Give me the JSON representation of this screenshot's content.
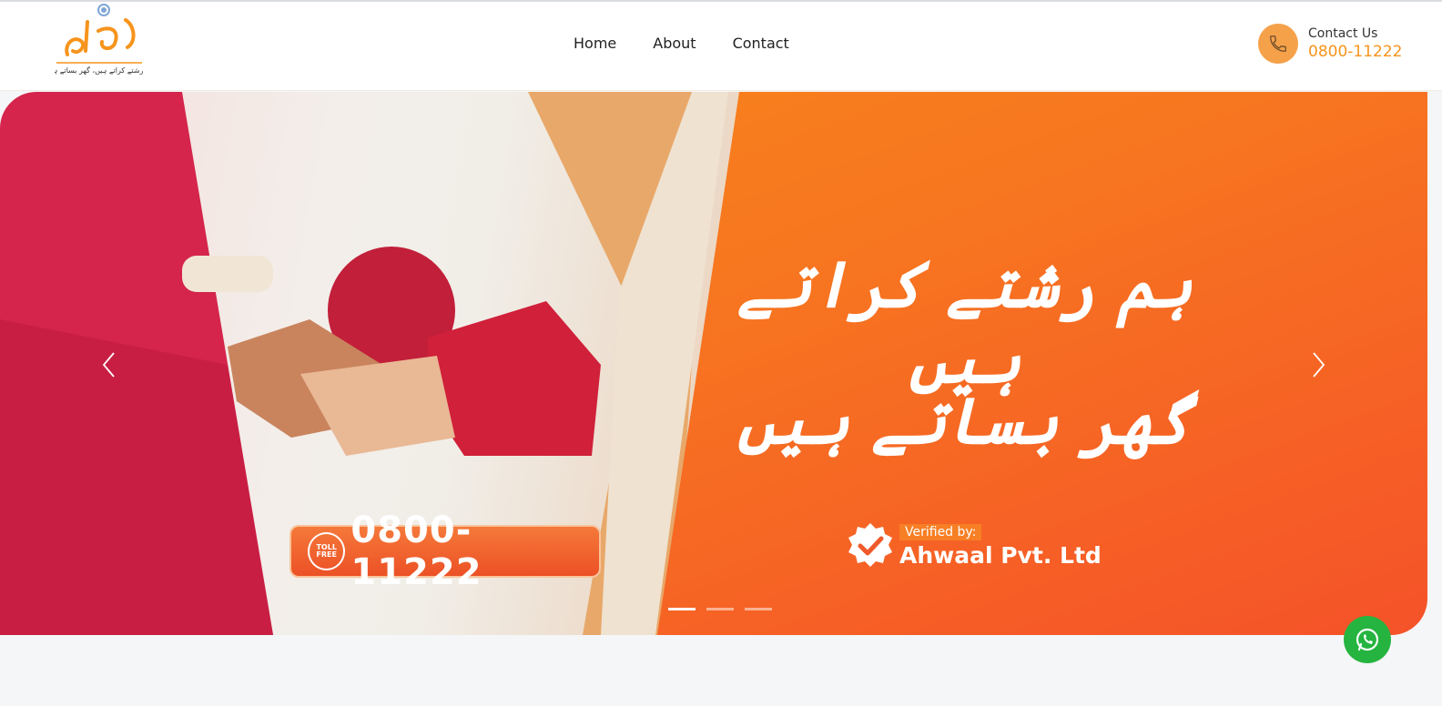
{
  "brand": {
    "logo_text": "احوال",
    "tagline": "ہم رشتے کراتے ہیں، گھر بساتے ہیں",
    "accent_color": "#f7941d"
  },
  "nav": {
    "items": [
      {
        "label": "Home"
      },
      {
        "label": "About"
      },
      {
        "label": "Contact"
      }
    ]
  },
  "contact": {
    "label": "Contact Us",
    "number": "0800-11222",
    "icon": "phone-icon"
  },
  "hero": {
    "headline_line1": "ہم رشتے کراتے ہیں",
    "headline_line2": "گھر بساتے ہیں",
    "toll_free_label": "TOLL FREE",
    "toll_free_number": "0800-11222",
    "verified_label": "Verified by:",
    "verified_company": "Ahwaal Pvt. Ltd",
    "slides_total": 3,
    "active_slide": 1
  },
  "floating": {
    "whatsapp_icon": "whatsapp-icon"
  }
}
